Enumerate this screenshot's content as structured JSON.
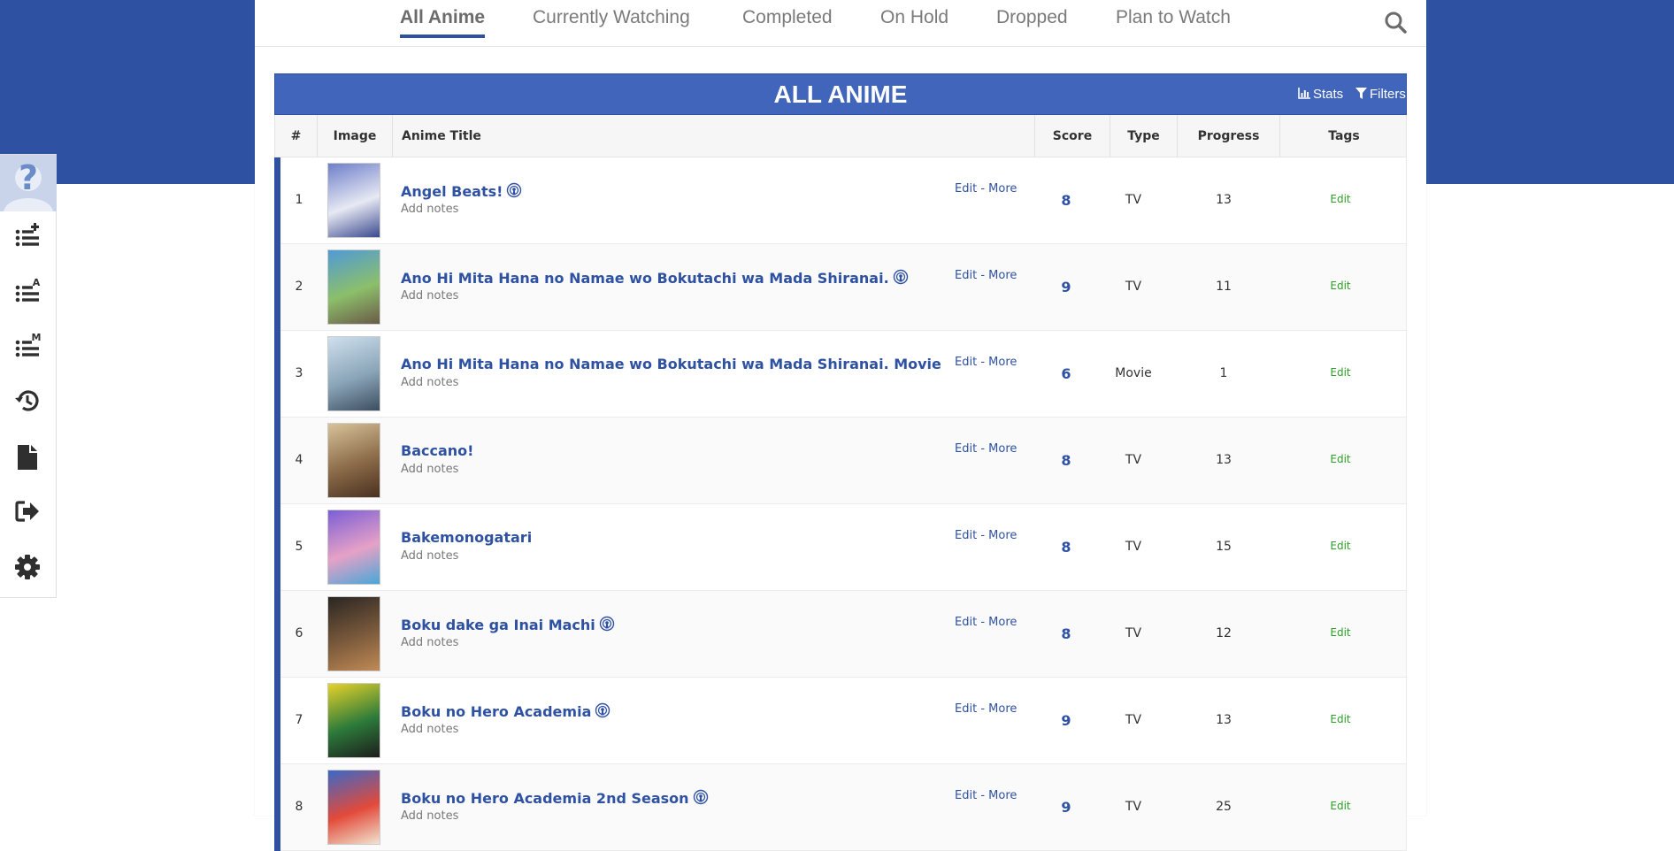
{
  "nav": {
    "tabs": [
      {
        "label": "All Anime",
        "active": true
      },
      {
        "label": "Currently Watching",
        "active": false
      },
      {
        "label": "Completed",
        "active": false
      },
      {
        "label": "On Hold",
        "active": false
      },
      {
        "label": "Dropped",
        "active": false
      },
      {
        "label": "Plan to Watch",
        "active": false
      }
    ],
    "search_icon": "search-icon"
  },
  "list_header": {
    "title": "ALL ANIME",
    "stats_label": "Stats",
    "filters_label": "Filters"
  },
  "table": {
    "columns": [
      "#",
      "Image",
      "Anime Title",
      "Score",
      "Type",
      "Progress",
      "Tags"
    ],
    "edit_label": "Edit",
    "more_label": "More",
    "separator": "-",
    "notes_label": "Add notes",
    "rows": [
      {
        "num": "1",
        "title": "Angel Beats!",
        "airing_icon": true,
        "score": "8",
        "type": "TV",
        "progress": "13",
        "tags": "Edit",
        "thumb_colors": [
          "#6e7fc9",
          "#e7e9f3",
          "#3b4a8f"
        ]
      },
      {
        "num": "2",
        "title": "Ano Hi Mita Hana no Namae wo Bokutachi wa Mada Shiranai.",
        "airing_icon": true,
        "score": "9",
        "type": "TV",
        "progress": "11",
        "tags": "Edit",
        "thumb_colors": [
          "#4f9ad8",
          "#8cbf6a",
          "#6a5a48"
        ]
      },
      {
        "num": "3",
        "title": "Ano Hi Mita Hana no Namae wo Bokutachi wa Mada Shiranai. Movie",
        "airing_icon": false,
        "score": "6",
        "type": "Movie",
        "progress": "1",
        "tags": "Edit",
        "thumb_colors": [
          "#cfe0ee",
          "#8aa5b8",
          "#3c4e5f"
        ]
      },
      {
        "num": "4",
        "title": "Baccano!",
        "airing_icon": false,
        "score": "8",
        "type": "TV",
        "progress": "13",
        "tags": "Edit",
        "thumb_colors": [
          "#d8c29a",
          "#8a6a48",
          "#4a3020"
        ]
      },
      {
        "num": "5",
        "title": "Bakemonogatari",
        "airing_icon": false,
        "score": "8",
        "type": "TV",
        "progress": "15",
        "tags": "Edit",
        "thumb_colors": [
          "#7b5ed6",
          "#e6a1c6",
          "#49a7d8"
        ]
      },
      {
        "num": "6",
        "title": "Boku dake ga Inai Machi",
        "airing_icon": true,
        "score": "8",
        "type": "TV",
        "progress": "12",
        "tags": "Edit",
        "thumb_colors": [
          "#2a2622",
          "#7b5a3c",
          "#c08a55"
        ]
      },
      {
        "num": "7",
        "title": "Boku no Hero Academia",
        "airing_icon": true,
        "score": "9",
        "type": "TV",
        "progress": "13",
        "tags": "Edit",
        "thumb_colors": [
          "#e7d22a",
          "#2c7a3a",
          "#1d1d1d"
        ]
      },
      {
        "num": "8",
        "title": "Boku no Hero Academia 2nd Season",
        "airing_icon": true,
        "score": "9",
        "type": "TV",
        "progress": "25",
        "tags": "Edit",
        "thumb_colors": [
          "#3a68c8",
          "#e34a3a",
          "#f0e4d0"
        ]
      }
    ]
  },
  "sidebar": {
    "avatar": "unknown-user-avatar",
    "buttons": [
      "add-to-list-icon",
      "list-a-icon",
      "list-m-icon",
      "history-icon",
      "document-icon",
      "logout-icon",
      "settings-icon"
    ]
  },
  "colors": {
    "brand_blue": "#2e51a2",
    "header_blue": "#4065ba",
    "tag_green": "#2ea028"
  }
}
